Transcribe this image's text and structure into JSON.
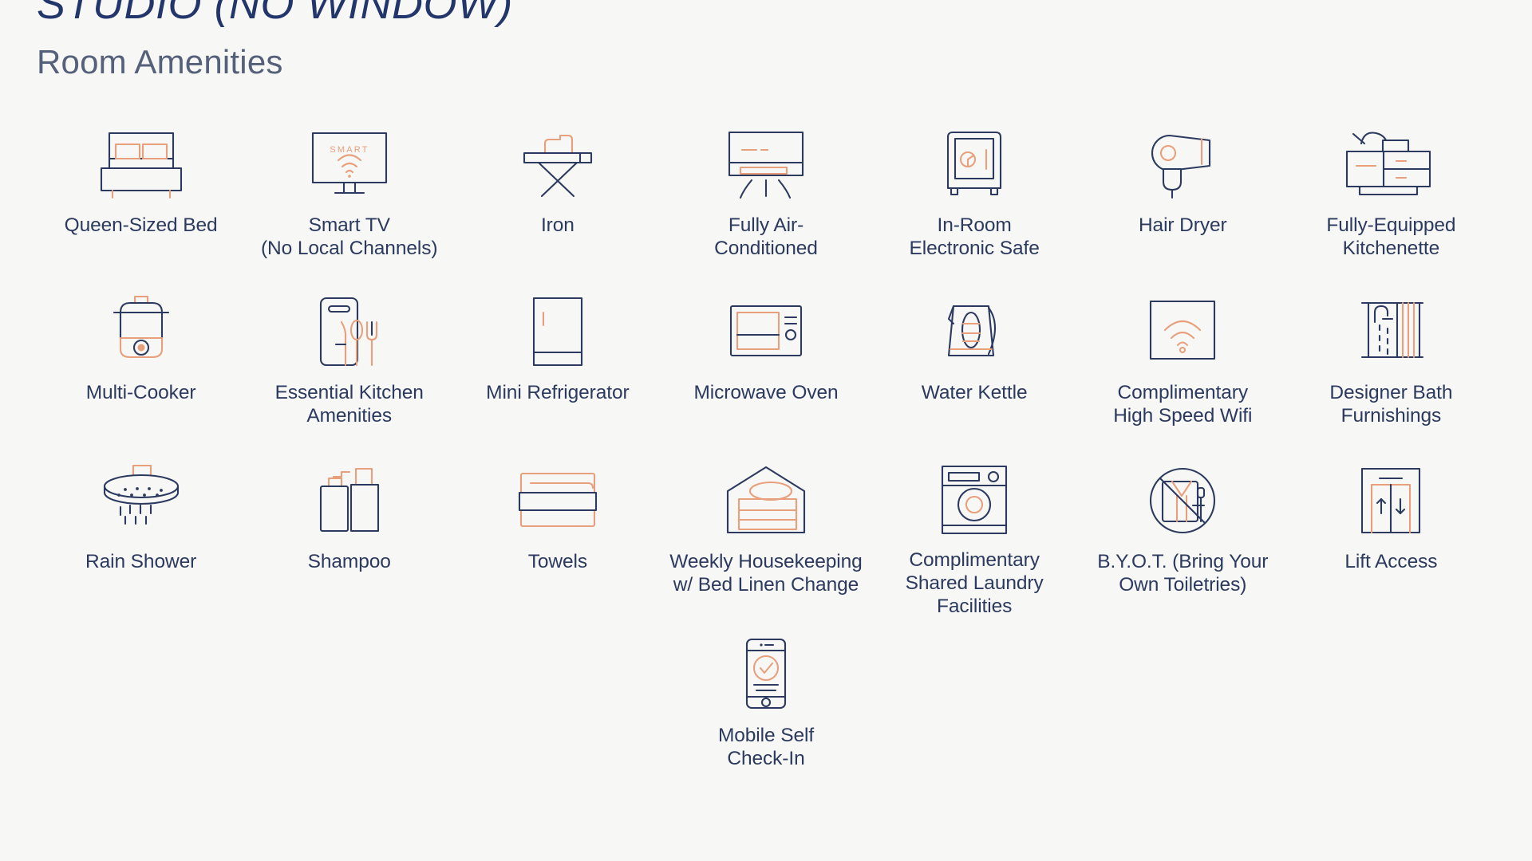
{
  "header": {
    "title": "STUDIO (NO WINDOW)",
    "subtitle": "Room Amenities"
  },
  "colors": {
    "background": "#f7f7f5",
    "navy": "#2b3a5e",
    "title_navy": "#23366b",
    "coral": "#e8a07c",
    "subtitle_grey": "#55607a"
  },
  "amenities": [
    {
      "icon": "bed-icon",
      "label": "Queen-Sized Bed"
    },
    {
      "icon": "smart-tv-icon",
      "label": "Smart TV\n(No Local Channels)"
    },
    {
      "icon": "iron-icon",
      "label": "Iron"
    },
    {
      "icon": "air-conditioner-icon",
      "label": "Fully Air-\nConditioned"
    },
    {
      "icon": "safe-icon",
      "label": "In-Room\nElectronic Safe"
    },
    {
      "icon": "hair-dryer-icon",
      "label": "Hair Dryer"
    },
    {
      "icon": "kitchenette-icon",
      "label": "Fully-Equipped\nKitchenette"
    },
    {
      "icon": "multi-cooker-icon",
      "label": "Multi-Cooker"
    },
    {
      "icon": "cutlery-board-icon",
      "label": "Essential Kitchen\nAmenities"
    },
    {
      "icon": "refrigerator-icon",
      "label": "Mini Refrigerator"
    },
    {
      "icon": "microwave-icon",
      "label": "Microwave Oven"
    },
    {
      "icon": "kettle-icon",
      "label": "Water Kettle"
    },
    {
      "icon": "wifi-icon",
      "label": "Complimentary\nHigh Speed Wifi"
    },
    {
      "icon": "shower-curtain-icon",
      "label": "Designer Bath\nFurnishings"
    },
    {
      "icon": "rain-shower-icon",
      "label": "Rain Shower"
    },
    {
      "icon": "shampoo-bottles-icon",
      "label": "Shampoo"
    },
    {
      "icon": "towels-icon",
      "label": "Towels"
    },
    {
      "icon": "housekeeping-icon",
      "label": "Weekly Housekeeping\nw/ Bed Linen Change"
    },
    {
      "icon": "washing-machine-icon",
      "label": "Complimentary\nShared Laundry\nFacilities"
    },
    {
      "icon": "no-toiletries-icon",
      "label": "B.Y.O.T. (Bring Your\nOwn Toiletries)"
    },
    {
      "icon": "elevator-icon",
      "label": "Lift Access"
    },
    {
      "icon": "mobile-checkin-icon",
      "label": "Mobile Self\nCheck-In"
    }
  ],
  "icon_text": {
    "smart_tv_screen_text": "SMART"
  }
}
